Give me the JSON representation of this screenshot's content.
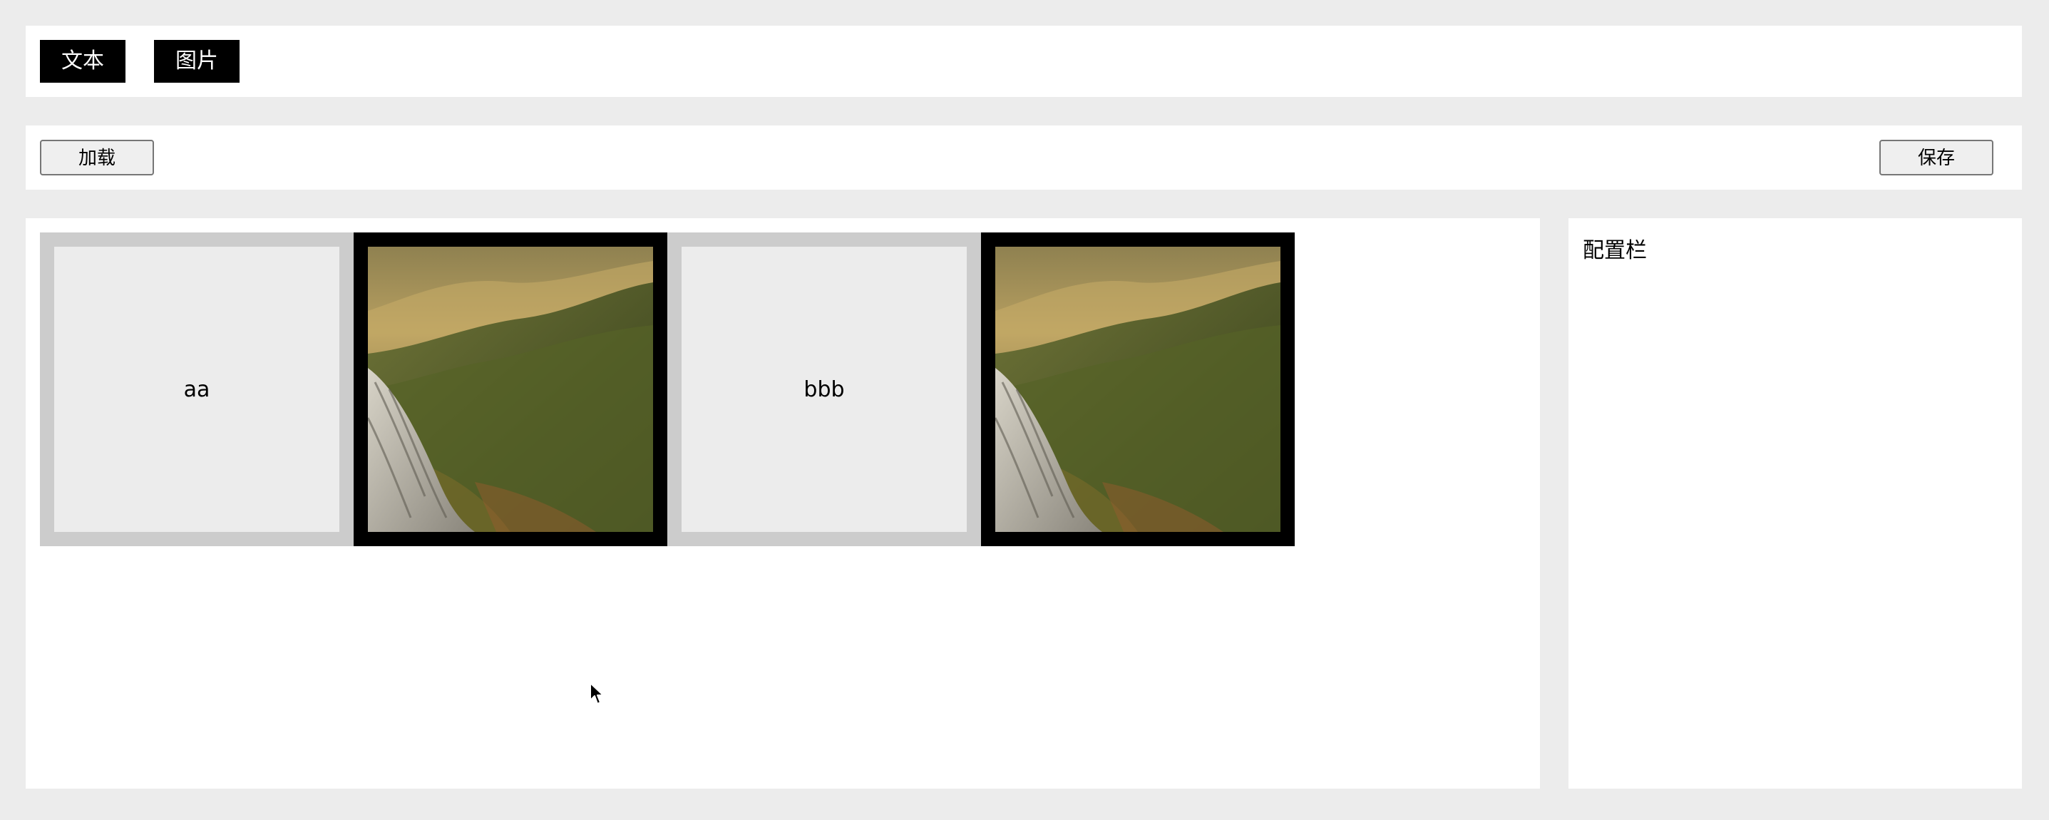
{
  "toolbar": {
    "text_label": "文本",
    "image_label": "图片"
  },
  "actions": {
    "load_label": "加载",
    "save_label": "保存"
  },
  "canvas": {
    "tiles": [
      {
        "type": "text",
        "text": "aa"
      },
      {
        "type": "image",
        "image": "landscape-image"
      },
      {
        "type": "text",
        "text": "bbb"
      },
      {
        "type": "image",
        "image": "landscape-image"
      }
    ]
  },
  "config": {
    "title": "配置栏"
  },
  "colors": {
    "background": "#ececec",
    "panel": "#ffffff",
    "tool_button": "#000000",
    "text_tile_border": "#cccccc",
    "image_tile_border": "#000000"
  }
}
